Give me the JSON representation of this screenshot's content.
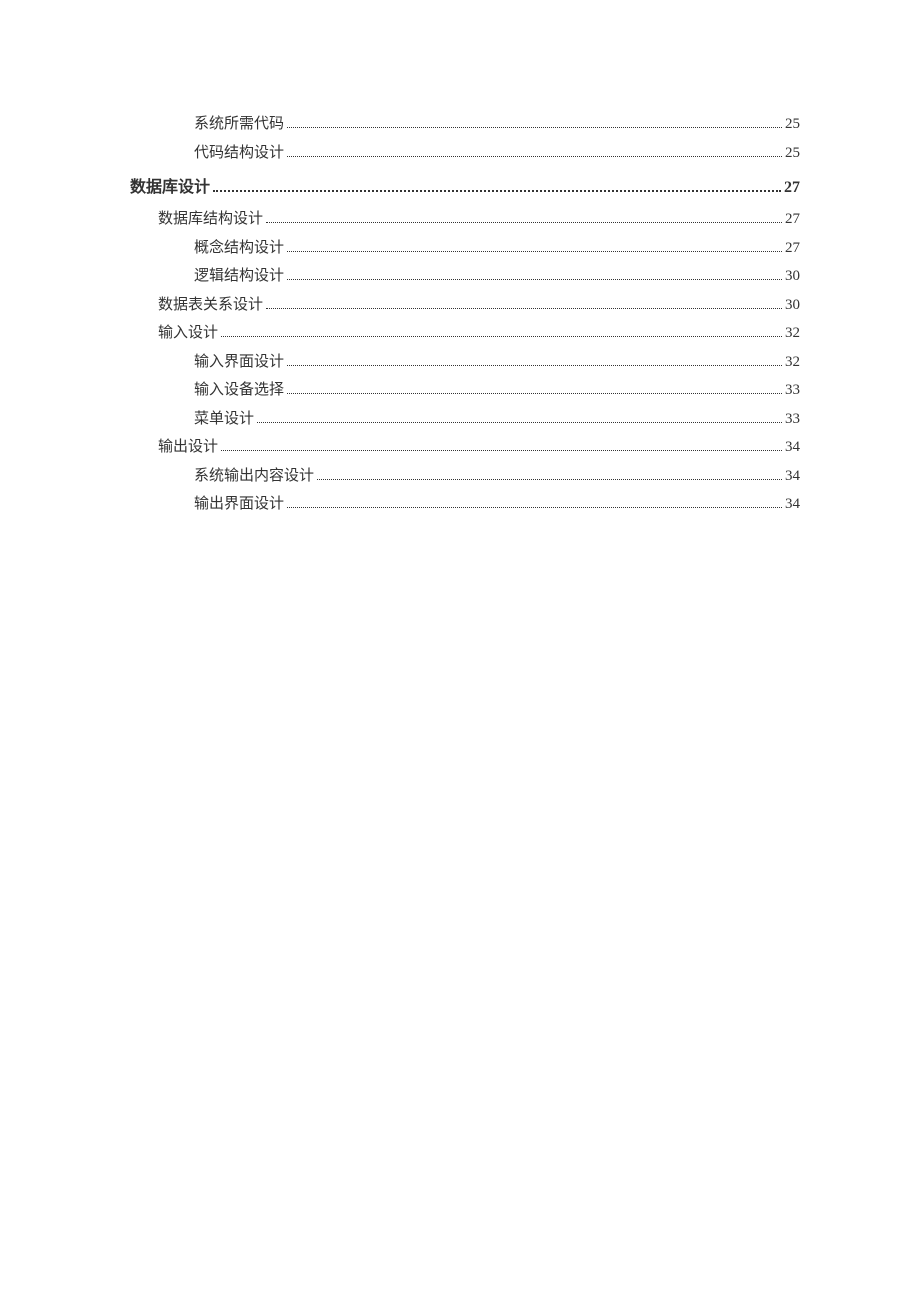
{
  "toc": [
    {
      "title": "系统所需代码",
      "page": "25",
      "level": 3
    },
    {
      "title": "代码结构设计",
      "page": "25",
      "level": 3
    },
    {
      "title": "数据库设计",
      "page": "27",
      "level": 0
    },
    {
      "title": "数据库结构设计",
      "page": "27",
      "level": 1
    },
    {
      "title": "概念结构设计",
      "page": "27",
      "level": 2
    },
    {
      "title": "逻辑结构设计",
      "page": "30",
      "level": 2
    },
    {
      "title": "数据表关系设计",
      "page": "30",
      "level": 1
    },
    {
      "title": "输入设计",
      "page": "32",
      "level": 1
    },
    {
      "title": "输入界面设计",
      "page": "32",
      "level": 2
    },
    {
      "title": "输入设备选择",
      "page": "33",
      "level": 2
    },
    {
      "title": "菜单设计",
      "page": "33",
      "level": 2
    },
    {
      "title": "输出设计",
      "page": "34",
      "level": 1
    },
    {
      "title": "系统输出内容设计",
      "page": "34",
      "level": 2
    },
    {
      "title": "输出界面设计",
      "page": "34",
      "level": 2
    }
  ]
}
